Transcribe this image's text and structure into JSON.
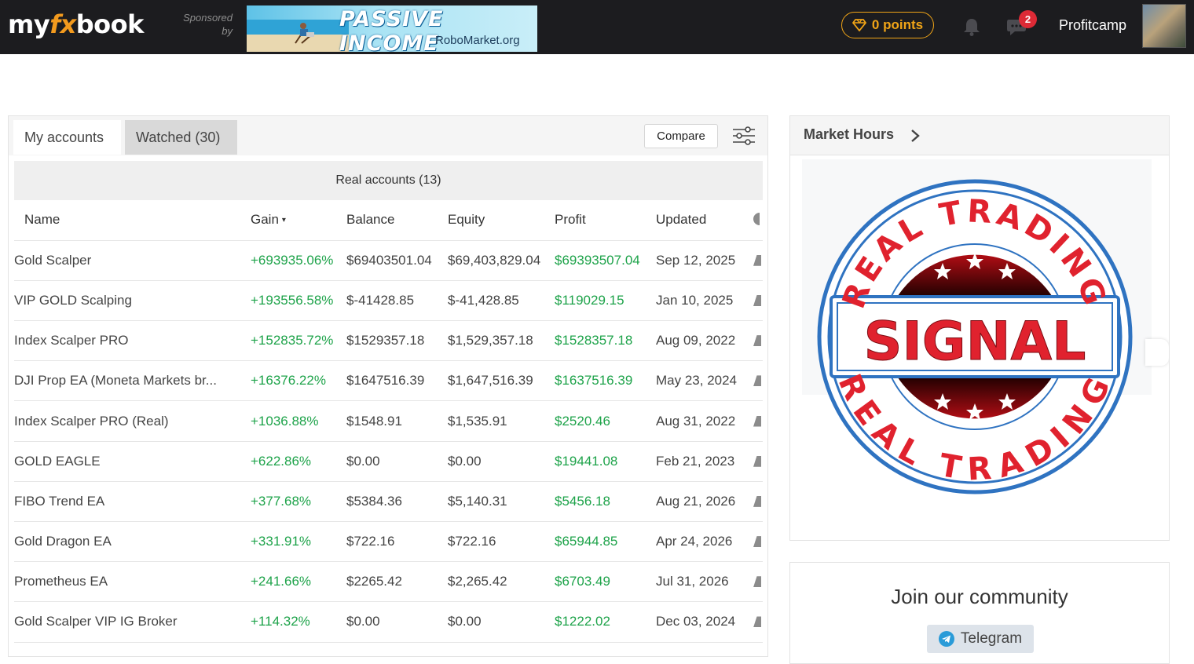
{
  "header": {
    "logo": {
      "my": "my",
      "fx": "fx",
      "book": "book"
    },
    "sponsored_line1": "Sponsored",
    "sponsored_line2": "by",
    "banner_headline": "PASSIVE INCOME",
    "banner_site": "RoboMarket.org",
    "points_label": "0 points",
    "notification_count": "2",
    "username": "Profitcamp",
    "colors": {
      "bar": "#1c1c1f",
      "points": "#f0a417",
      "badge": "#dd2a36"
    }
  },
  "accounts_panel": {
    "tabs": {
      "mine": "My accounts",
      "watched": "Watched  (30)"
    },
    "compare_label": "Compare",
    "section_title": "Real accounts (13)",
    "columns": [
      "Name",
      "Gain",
      "Balance",
      "Equity",
      "Profit",
      "Updated"
    ],
    "sort_indicator": "▾",
    "rows": [
      [
        "Gold Scalper",
        "+693935.06%",
        "$69403501.04",
        "$69,403,829.04",
        "$69393507.04",
        "Sep 12, 2025"
      ],
      [
        "VIP GOLD Scalping",
        "+193556.58%",
        "$-41428.85",
        "$-41,428.85",
        "$119029.15",
        "Jan 10, 2025"
      ],
      [
        "Index Scalper PRO",
        "+152835.72%",
        "$1529357.18",
        "$1,529,357.18",
        "$1528357.18",
        "Aug 09, 2022"
      ],
      [
        "DJI Prop EA (Moneta Markets br...",
        "+16376.22%",
        "$1647516.39",
        "$1,647,516.39",
        "$1637516.39",
        "May 23, 2024"
      ],
      [
        "Index Scalper PRO (Real)",
        "+1036.88%",
        "$1548.91",
        "$1,535.91",
        "$2520.46",
        "Aug 31, 2022"
      ],
      [
        "GOLD EAGLE",
        "+622.86%",
        "$0.00",
        "$0.00",
        "$19441.08",
        "Feb 21, 2023"
      ],
      [
        "FIBO Trend EA",
        "+377.68%",
        "$5384.36",
        "$5,140.31",
        "$5456.18",
        "Aug 21, 2026"
      ],
      [
        "Gold Dragon EA",
        "+331.91%",
        "$722.16",
        "$722.16",
        "$65944.85",
        "Apr 24, 2026"
      ],
      [
        "Prometheus EA",
        "+241.66%",
        "$2265.42",
        "$2,265.42",
        "$6703.49",
        "Jul 31, 2026"
      ],
      [
        "Gold Scalper VIP IG Broker",
        "+114.32%",
        "$0.00",
        "$0.00",
        "$1222.02",
        "Dec 03, 2024"
      ]
    ],
    "colors": {
      "positive": "#1ea34a"
    }
  },
  "market_hours": {
    "title": "Market Hours"
  },
  "stamp": {
    "top_text": "REAL TRADING",
    "center_text": "SIGNAL",
    "bottom_text": "REAL TRADING",
    "colors": {
      "ring": "#2f73c1",
      "text": "#e0222e"
    }
  },
  "community": {
    "title": "Join our community",
    "telegram_label": "Telegram"
  }
}
